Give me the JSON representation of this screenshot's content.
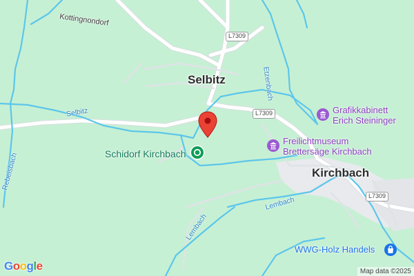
{
  "map": {
    "places": {
      "selbitz": "Selbitz",
      "kirchbach": "Kirchbach",
      "kottingnondorf": "Kottingnondorf"
    },
    "roads": {
      "l7309_a": "L7309",
      "l7309_b": "L7309",
      "l7309_c": "L7309"
    },
    "waterways": {
      "selbitz_stream": "Selbitz",
      "etzenbach": "Etzenbach",
      "rebeisbach": "Rebeisbach",
      "lembach_1": "Lembach",
      "lembach_2": "Lembach"
    },
    "pois": {
      "grafikkabinett_line1": "Grafikkabinett",
      "grafikkabinett_line2": "Erich Steininger",
      "freilichtmuseum_line1": "Freilichtmuseum",
      "freilichtmuseum_line2": "Brettersäge Kirchbach",
      "schidorf": "Schidorf Kirchbach",
      "wwg": "WWG-Holz Handels"
    },
    "icons": {
      "pin": "map-pin-icon",
      "museum": "museum-icon",
      "park": "park-icon",
      "shop": "shopping-bag-icon"
    },
    "colors": {
      "land": "#c6f0d4",
      "water": "#5cc6ea",
      "road": "#ffffff",
      "settlement": "#e8eaed",
      "pin": "#ea4335",
      "poi_purple": "#8a3fbf",
      "poi_green": "#0f9d58",
      "poi_blue": "#1a73e8"
    },
    "logo_letters": [
      "G",
      "o",
      "o",
      "g",
      "l",
      "e"
    ],
    "attribution": "Map data ©2025"
  }
}
